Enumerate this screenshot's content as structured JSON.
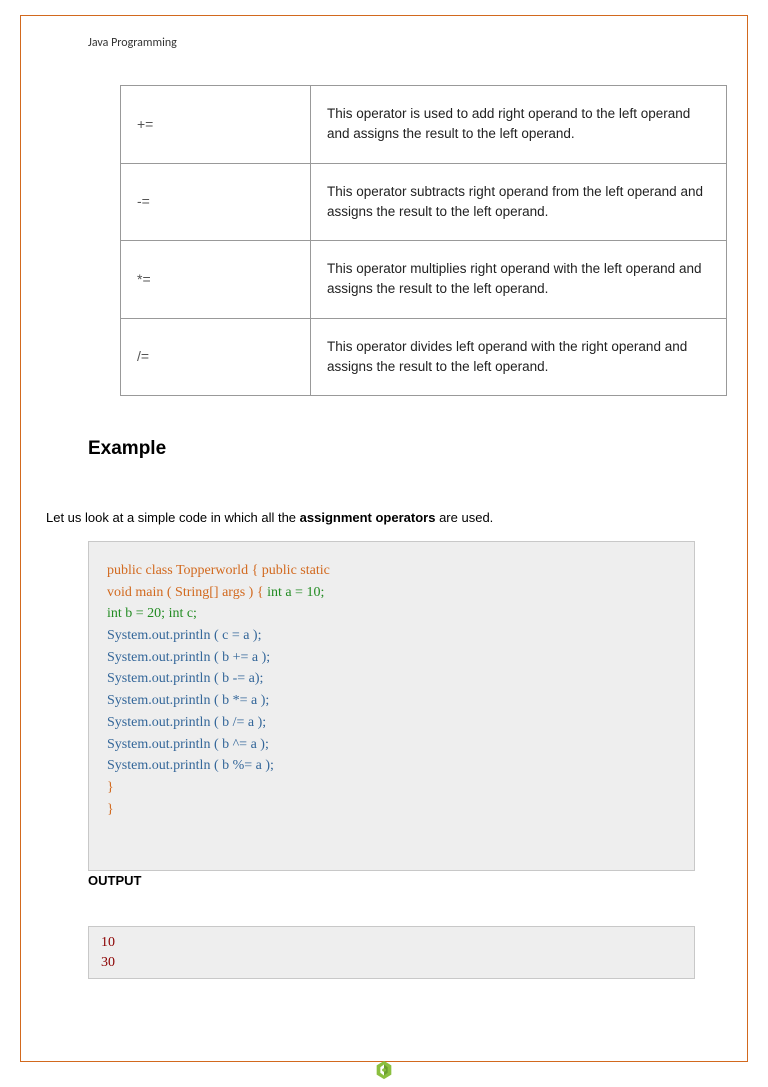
{
  "header": {
    "title": "Java Programming"
  },
  "table": {
    "rows": [
      {
        "sym": "+=",
        "desc": "This operator is used to add right operand to the left operand and assigns the result to the left operand."
      },
      {
        "sym": "-=",
        "desc": "This operator subtracts right operand from the left operand and assigns the result to the left operand."
      },
      {
        "sym": "*=",
        "desc": "This operator multiplies right operand with the left operand and assigns the result to the left operand."
      },
      {
        "sym": "/=",
        "desc": "This operator divides left operand with the right operand and assigns the result to the left operand."
      }
    ]
  },
  "example": {
    "heading": "Example",
    "intro_pre": "Let us look at a simple code in which all the  ",
    "intro_bold": "assignment operators",
    "intro_post": " are used."
  },
  "code": {
    "line1a": "public class Topperworld { public static",
    "line2a": "void main ( String[] args ) { ",
    "line2b": "int a = 10;",
    "line3": "int b = 20; int c;",
    "line4": "System.out.println ( c = a );",
    "line5": "System.out.println ( b += a );",
    "line6": "System.out.println ( b -= a);",
    "line7": "System.out.println ( b *= a );",
    "line8": "System.out.println ( b /= a );",
    "line9": "System.out.println ( b ^= a );",
    "line10": "System.out.println ( b %= a );",
    "line11": "}",
    "line12": "}"
  },
  "output": {
    "label": "OUTPUT",
    "line1": "10",
    "line2": "30"
  }
}
